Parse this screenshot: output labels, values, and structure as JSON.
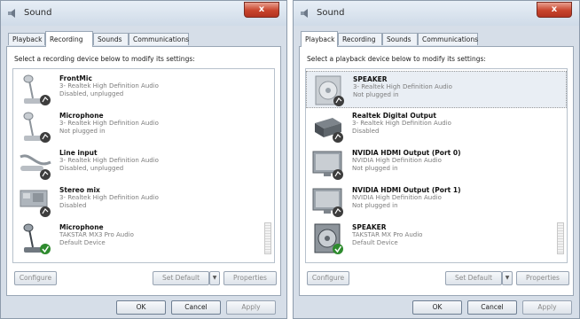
{
  "left": {
    "title": "Sound",
    "close_label": "x",
    "tabs": [
      "Playback",
      "Recording",
      "Sounds",
      "Communications"
    ],
    "active_tab": "Recording",
    "instruction": "Select a recording device below to modify its settings:",
    "devices": [
      {
        "name": "FrontMic",
        "line1": "3- Realtek High Definition Audio",
        "line2": "Disabled, unplugged",
        "icon": "microphone-icon"
      },
      {
        "name": "Microphone",
        "line1": "3- Realtek High Definition Audio",
        "line2": "Not plugged in",
        "icon": "microphone-icon"
      },
      {
        "name": "Line input",
        "line1": "3- Realtek High Definition Audio",
        "line2": "Disabled, unplugged",
        "icon": "line-input-icon"
      },
      {
        "name": "Stereo mix",
        "line1": "3- Realtek High Definition Audio",
        "line2": "Disabled",
        "icon": "sound-card-icon"
      },
      {
        "name": "Microphone",
        "line1": "TAKSTAR MX3 Pro Audio",
        "line2": "Default Device",
        "icon": "microphone-icon"
      }
    ],
    "buttons": {
      "configure": "Configure",
      "set_default": "Set Default",
      "properties": "Properties",
      "ok": "OK",
      "cancel": "Cancel",
      "apply": "Apply"
    }
  },
  "right": {
    "title": "Sound",
    "close_label": "x",
    "tabs": [
      "Playback",
      "Recording",
      "Sounds",
      "Communications"
    ],
    "active_tab": "Playback",
    "instruction": "Select a playback device below to modify its settings:",
    "devices": [
      {
        "name": "SPEAKER",
        "line1": "3- Realtek High Definition Audio",
        "line2": "Not plugged in",
        "icon": "speaker-icon"
      },
      {
        "name": "Realtek Digital Output",
        "line1": "3- Realtek High Definition Audio",
        "line2": "Disabled",
        "icon": "digital-output-icon"
      },
      {
        "name": "NVIDIA HDMI Output (Port 0)",
        "line1": "NVIDIA High Definition Audio",
        "line2": "Not plugged in",
        "icon": "monitor-icon"
      },
      {
        "name": "NVIDIA HDMI Output (Port 1)",
        "line1": "NVIDIA High Definition Audio",
        "line2": "Not plugged in",
        "icon": "monitor-icon"
      },
      {
        "name": "SPEAKER",
        "line1": "TAKSTAR MX  Pro Audio",
        "line2": "Default Device",
        "icon": "speaker-icon"
      }
    ],
    "buttons": {
      "configure": "Configure",
      "set_default": "Set Default",
      "properties": "Properties",
      "ok": "OK",
      "cancel": "Cancel",
      "apply": "Apply"
    }
  },
  "colors": {
    "window_bg": "#d6dee8",
    "status_gray": "#7b7b7b",
    "check_green": "#2e8b2e"
  }
}
